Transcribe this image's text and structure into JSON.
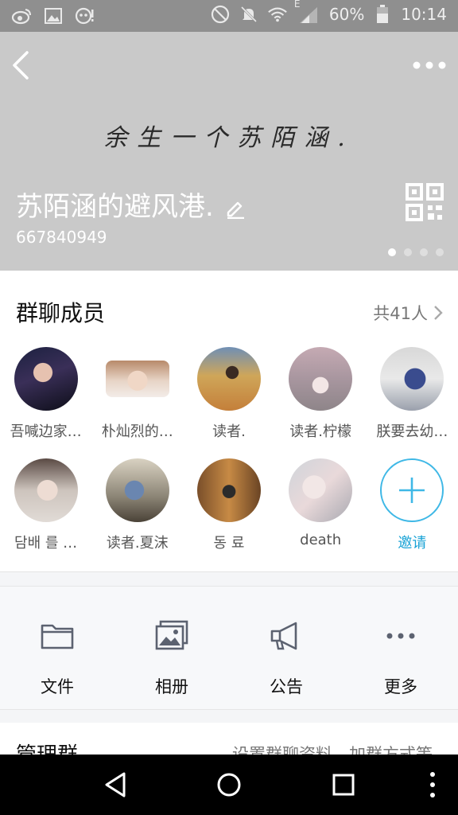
{
  "status_bar": {
    "battery": "60%",
    "time": "10:14",
    "network": "E",
    "icons": [
      "weibo-icon",
      "image-icon",
      "assistant-icon",
      "dnd-icon",
      "mute-icon",
      "wifi-icon",
      "signal-icon",
      "battery-icon"
    ]
  },
  "header": {
    "banner_text": "余生一个苏陌涵.",
    "group_name": "苏陌涵的避风港.",
    "group_id": "667840949",
    "page_indicators": 4,
    "active_indicator": 1,
    "background": "#c9c9c9"
  },
  "members": {
    "title": "群聊成员",
    "count": "共41人",
    "list": [
      {
        "name": "吾喊边家…"
      },
      {
        "name": "朴灿烈的…"
      },
      {
        "name": "读者."
      },
      {
        "name": "读者.柠檬"
      },
      {
        "name": "朕要去幼…"
      },
      {
        "name": "담배 를 …"
      },
      {
        "name": "读者.夏沫"
      },
      {
        "name": "동 료"
      },
      {
        "name": "death"
      }
    ],
    "invite_label": "邀请",
    "accent": "#1aa3d6"
  },
  "actions": [
    {
      "label": "文件",
      "icon": "folder-icon"
    },
    {
      "label": "相册",
      "icon": "album-icon"
    },
    {
      "label": "公告",
      "icon": "megaphone-icon"
    },
    {
      "label": "更多",
      "icon": "more-icon"
    }
  ],
  "manage": {
    "title": "管理群",
    "subtitle": "设置群聊资料、加群方式等"
  }
}
